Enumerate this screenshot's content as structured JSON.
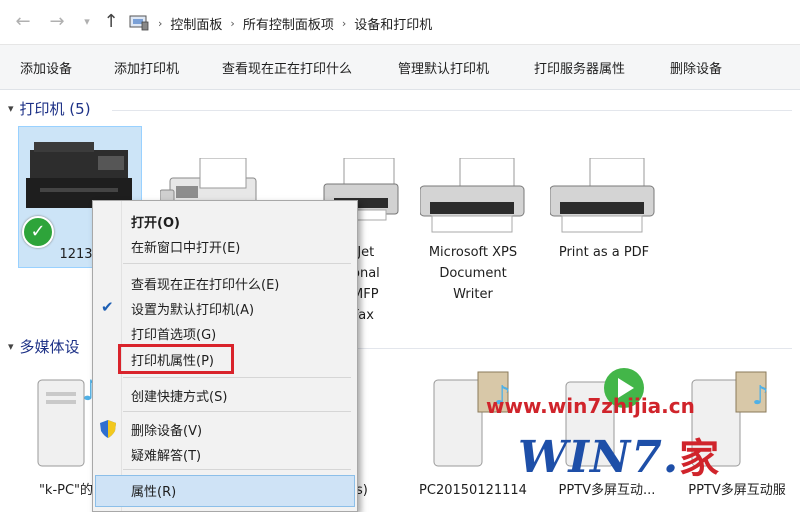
{
  "address_bar": {
    "crumbs": [
      "控制面板",
      "所有控制面板项",
      "设备和打印机"
    ]
  },
  "toolbar": {
    "buttons": [
      "添加设备",
      "添加打印机",
      "查看现在正在打印什么",
      "管理默认打印机",
      "打印服务器属性",
      "删除设备"
    ]
  },
  "groups": {
    "printers": {
      "label": "打印机 (5)"
    },
    "multimedia": {
      "label": "多媒体设"
    }
  },
  "printers": [
    {
      "name": "1213",
      "default": true
    },
    {
      "name": ""
    },
    {
      "name_lines": [
        "rJet",
        "onal",
        "MFP",
        "Fax"
      ]
    },
    {
      "name_lines": [
        "Microsoft XPS",
        "Document",
        "Writer"
      ]
    },
    {
      "name_lines": [
        "Print as a PDF"
      ]
    }
  ],
  "media_devices": [
    {
      "name": "\"k-PC\"的"
    },
    {
      "name": "s)"
    },
    {
      "name": "PC20150121114"
    },
    {
      "name": "PPTV多屏互动..."
    },
    {
      "name": "PPTV多屏互动服"
    }
  ],
  "context_menu": {
    "items": [
      {
        "label": "打开(O)",
        "bold": true
      },
      {
        "label": "在新窗口中打开(E)"
      },
      {
        "label": "查看现在正在打印什么(E)"
      },
      {
        "label": "设置为默认打印机(A)",
        "checked": true
      },
      {
        "label": "打印首选项(G)"
      },
      {
        "label": "打印机属性(P)",
        "highlighted": true
      },
      {
        "label": "创建快捷方式(S)"
      },
      {
        "label": "删除设备(V)",
        "shield": true
      },
      {
        "label": "疑难解答(T)"
      },
      {
        "label": "属性(R)"
      }
    ]
  },
  "watermark": {
    "url": "www.win7zhijia.cn",
    "logo": "WIN7.",
    "logo_cn": "家"
  },
  "colors": {
    "selection_bg": "#cce4f7",
    "highlight_border": "#d9232b",
    "group_text": "#1e3287",
    "logo_blue": "#1e4fa8"
  }
}
